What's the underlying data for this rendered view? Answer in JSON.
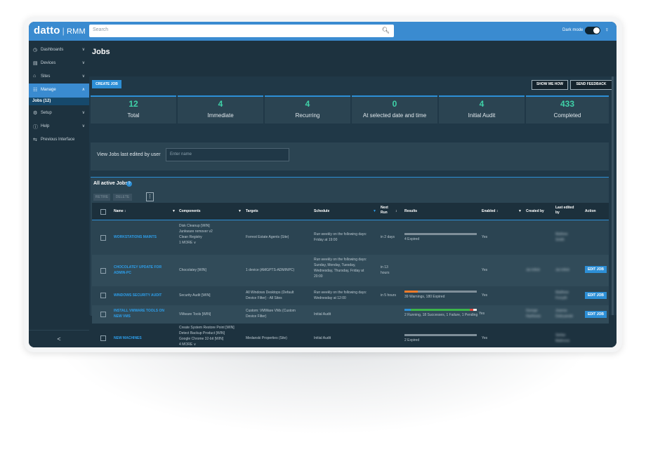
{
  "header": {
    "logo": "datto",
    "logo_sep": "|",
    "logo_product": "RMM",
    "search_placeholder": "Search",
    "dark_mode_label": "Dark mode",
    "dark_mode_on": true
  },
  "sidebar": {
    "items": [
      {
        "label": "Dashboards",
        "icon": "dashboard-icon"
      },
      {
        "label": "Devices",
        "icon": "devices-icon"
      },
      {
        "label": "Sites",
        "icon": "home-icon"
      },
      {
        "label": "Manage",
        "icon": "manage-icon"
      },
      {
        "label": "Setup",
        "icon": "gear-icon"
      },
      {
        "label": "Help",
        "icon": "help-icon"
      },
      {
        "label": "Previous Interface",
        "icon": "swap-icon"
      }
    ],
    "sub_item": "Jobs (12)",
    "collapse": "<"
  },
  "page": {
    "title": "Jobs",
    "create_job": "CREATE JOB",
    "show_me_how": "SHOW ME HOW",
    "send_feedback": "SEND FEEDBACK"
  },
  "stats": [
    {
      "value": "12",
      "label": "Total"
    },
    {
      "value": "4",
      "label": "Immediate"
    },
    {
      "value": "4",
      "label": "Recurring"
    },
    {
      "value": "0",
      "label": "At selected date and time"
    },
    {
      "value": "4",
      "label": "Initial Audit"
    },
    {
      "value": "433",
      "label": "Completed"
    }
  ],
  "filter": {
    "label": "View Jobs last edited by user",
    "placeholder": "Enter name"
  },
  "jobs": {
    "title": "All active Jobs",
    "help": "?",
    "retire": "RETIRE",
    "delete": "DELETE",
    "more": "⋮",
    "columns": {
      "name": "Name",
      "components": "Components",
      "targets": "Targets",
      "schedule": "Schedule",
      "next_run_1": "Next",
      "next_run_2": "Run",
      "results": "Results",
      "enabled": "Enabled",
      "created_by": "Created by",
      "last_edited_1": "Last edited",
      "last_edited_2": "by",
      "action": "Action"
    },
    "edit_label": "EDIT JOB",
    "rows": [
      {
        "name": "WORKSTATIONS MAINTS",
        "components": [
          "Disk Cleanup [WIN]",
          "Junkware remover v2",
          "Clean Registry"
        ],
        "more": "1 MORE",
        "targets": [
          "Forrest Estate Agents (Site)"
        ],
        "schedule": [
          "Run weekly on the following days:",
          "Friday at 19:00"
        ],
        "next_run": [
          "in 2 days"
        ],
        "results": "4 Expired",
        "enabled": "Yes",
        "created_by": "",
        "last_edited": "Mathew Smith"
      },
      {
        "name_lines": [
          "CHOCOLATEY UPDATE FOR",
          "ADMIN-PC"
        ],
        "components": [
          "Chocolatey [WIN]"
        ],
        "targets": [
          "1 device (AMGPTS-ADMINPC)"
        ],
        "schedule": [
          "Run weekly on the following days:",
          "Sunday, Monday, Tuesday,",
          "Wednesday, Thursday, Friday at",
          "20:00"
        ],
        "next_run": [
          "in 13",
          "hours"
        ],
        "results": "",
        "enabled": "Yes",
        "created_by": "Jai Infinit",
        "last_edited": "Jai Infinit"
      },
      {
        "name": "WINDOWS SECURITY AUDIT",
        "components": [
          "Security Audit [WIN]"
        ],
        "targets": [
          "All Windows Desktops (Default",
          "Device Filter) - All Sites"
        ],
        "schedule": [
          "Run weekly on the following days:",
          "Wednesday at 12:00"
        ],
        "next_run": [
          "in 5 hours"
        ],
        "results": "39 Warnings, 180 Expired",
        "enabled": "Yes",
        "created_by": "",
        "last_edited": "Matthew Forsyth"
      },
      {
        "name_lines": [
          "INSTALL VMWARE TOOLS ON",
          "NEW VMS"
        ],
        "components": [
          "VMware Tools [WIN]"
        ],
        "targets": [
          "Custom: VMWare VMs (Custom",
          "Device Filter)"
        ],
        "schedule": [
          "Initial Audit"
        ],
        "next_run": [],
        "results": "2 Running, 18 Successes, 1 Failure, 1 Pending",
        "enabled": "Yes",
        "created_by": "George Harthesis",
        "last_edited": "Joanna Dobryanski"
      },
      {
        "name": "NEW MACHINES",
        "components": [
          "Create System Restore Point [WIN]",
          "Detect Backup Product [WIN]",
          "Google Chrome 32-bit [WIN]"
        ],
        "more": "4 MORE",
        "targets": [
          "Medanski Properties (Site)"
        ],
        "schedule": [
          "Initial Audit"
        ],
        "next_run": [],
        "results": "2 Expired",
        "enabled": "Yes",
        "created_by": "",
        "last_edited": "Stefan Malinova"
      }
    ]
  },
  "colors": {
    "accent": "#2d8fd6",
    "stat_value": "#3fd1a8",
    "warning": "#f07c2a",
    "success": "#3cb54a",
    "failure": "#e0463c",
    "expired": "#7f8f99"
  },
  "result_bars": {
    "row1": {
      "expired": 1.0
    },
    "row3": {
      "warnings": 0.18,
      "expired": 0.82
    },
    "row4": {
      "running": 0.09,
      "success": 0.82,
      "failure": 0.045,
      "pending": 0.045
    },
    "row5": {
      "expired": 1.0
    }
  }
}
